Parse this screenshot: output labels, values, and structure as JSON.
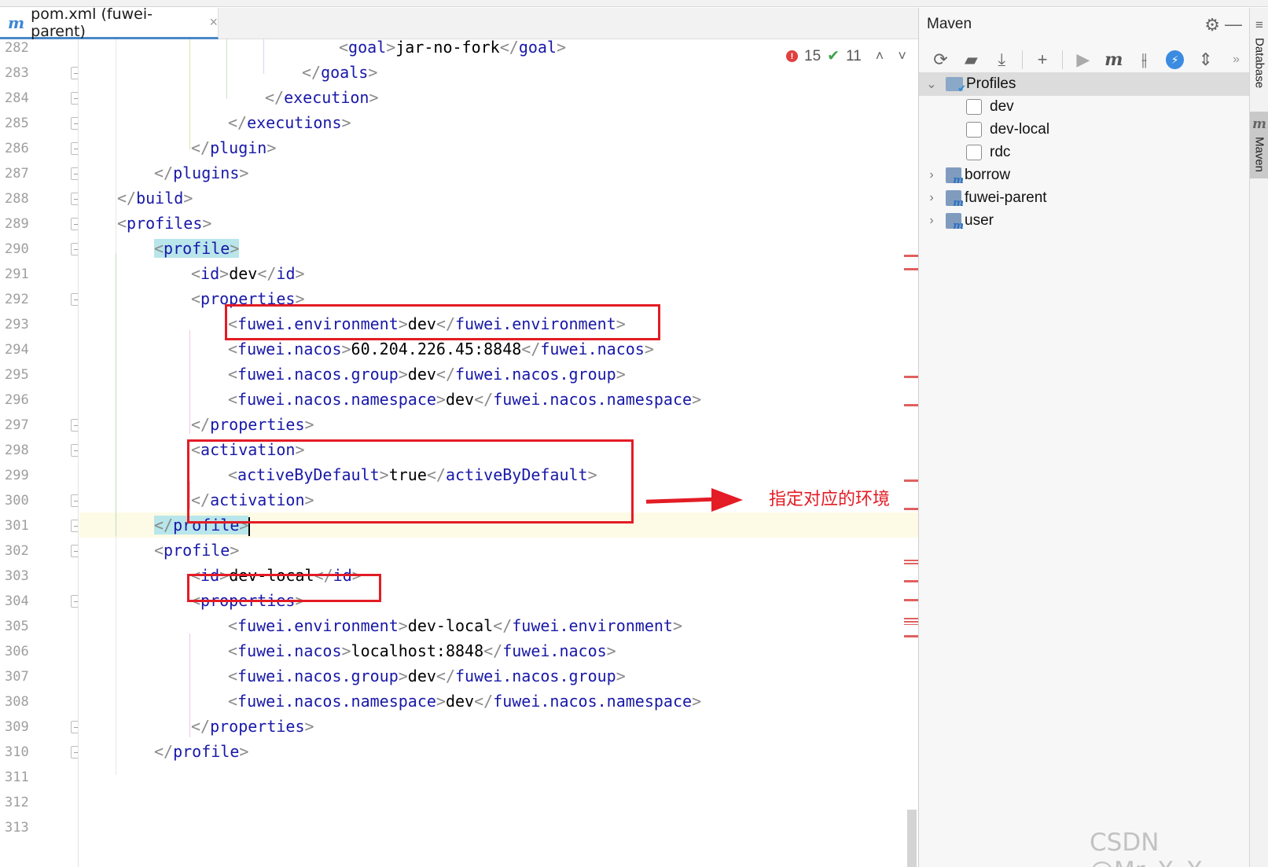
{
  "tab": {
    "icon": "m",
    "label": "pom.xml (fuwei-parent)",
    "close": "×"
  },
  "inspections": {
    "errors": "15",
    "weak_warnings": "11",
    "prev": "˄",
    "next": "˅"
  },
  "gutter": {
    "line_numbers": [
      "282",
      "283",
      "284",
      "285",
      "286",
      "287",
      "288",
      "289",
      "290",
      "291",
      "292",
      "293",
      "294",
      "295",
      "296",
      "297",
      "298",
      "299",
      "300",
      "301",
      "302",
      "303",
      "304",
      "305",
      "306",
      "307",
      "308",
      "309",
      "310",
      "311",
      "312",
      "313"
    ]
  },
  "code": {
    "lines": [
      {
        "n": "282",
        "indent": 12,
        "open": "<",
        "tag": "goal",
        "close": ">",
        "text": "jar-no-fork",
        "open2": "</",
        "tag2": "goal",
        "close2": ">"
      },
      {
        "n": "283",
        "indent": 10,
        "open": "</",
        "tag": "goals",
        "close": ">"
      },
      {
        "n": "284",
        "indent": 8,
        "open": "</",
        "tag": "execution",
        "close": ">"
      },
      {
        "n": "285",
        "indent": 6,
        "open": "</",
        "tag": "executions",
        "close": ">"
      },
      {
        "n": "286",
        "indent": 4,
        "open": "</",
        "tag": "plugin",
        "close": ">"
      },
      {
        "n": "287",
        "indent": 2,
        "open": "</",
        "tag": "plugins",
        "close": ">"
      },
      {
        "n": "288",
        "indent": 0,
        "open": "</",
        "tag": "build",
        "close": ">"
      },
      {
        "n": "289",
        "indent": 0,
        "open": "<",
        "tag": "profiles",
        "close": ">"
      },
      {
        "n": "290",
        "indent": 2,
        "open": "<",
        "tag": "profile",
        "close": ">",
        "highlight": true
      },
      {
        "n": "291",
        "indent": 4,
        "open": "<",
        "tag": "id",
        "close": ">",
        "text": "dev",
        "open2": "</",
        "tag2": "id",
        "close2": ">"
      },
      {
        "n": "292",
        "indent": 4,
        "open": "<",
        "tag": "properties",
        "close": ">"
      },
      {
        "n": "293",
        "indent": 6,
        "open": "<",
        "tag": "fuwei.environment",
        "close": ">",
        "text": "dev",
        "open2": "</",
        "tag2": "fuwei.environment",
        "close2": ">"
      },
      {
        "n": "294",
        "indent": 6,
        "open": "<",
        "tag": "fuwei.nacos",
        "close": ">",
        "text": "60.204.226.45:8848",
        "open2": "</",
        "tag2": "fuwei.nacos",
        "close2": ">"
      },
      {
        "n": "295",
        "indent": 6,
        "open": "<",
        "tag": "fuwei.nacos.group",
        "close": ">",
        "text": "dev",
        "open2": "</",
        "tag2": "fuwei.nacos.group",
        "close2": ">"
      },
      {
        "n": "296",
        "indent": 6,
        "open": "<",
        "tag": "fuwei.nacos.namespace",
        "close": ">",
        "text": "dev",
        "open2": "</",
        "tag2": "fuwei.nacos.namespace",
        "close2": ">"
      },
      {
        "n": "297",
        "indent": 4,
        "open": "</",
        "tag": "properties",
        "close": ">"
      },
      {
        "n": "298",
        "indent": 4,
        "open": "<",
        "tag": "activation",
        "close": ">"
      },
      {
        "n": "299",
        "indent": 6,
        "open": "<",
        "tag": "activeByDefault",
        "close": ">",
        "text": "true",
        "open2": "</",
        "tag2": "activeByDefault",
        "close2": ">"
      },
      {
        "n": "300",
        "indent": 4,
        "open": "</",
        "tag": "activation",
        "close": ">"
      },
      {
        "n": "301",
        "indent": 2,
        "open": "</",
        "tag": "profile",
        "close": ">",
        "highlight": true,
        "current": true
      },
      {
        "n": "302",
        "indent": 2,
        "open": "<",
        "tag": "profile",
        "close": ">"
      },
      {
        "n": "303",
        "indent": 4,
        "open": "<",
        "tag": "id",
        "close": ">",
        "text": "dev-local",
        "open2": "</",
        "tag2": "id",
        "close2": ">"
      },
      {
        "n": "304",
        "indent": 4,
        "open": "<",
        "tag": "properties",
        "close": ">"
      },
      {
        "n": "305",
        "indent": 6,
        "open": "<",
        "tag": "fuwei.environment",
        "close": ">",
        "text": "dev-local",
        "open2": "</",
        "tag2": "fuwei.environment",
        "close2": ">"
      },
      {
        "n": "306",
        "indent": 6,
        "open": "<",
        "tag": "fuwei.nacos",
        "close": ">",
        "text": "localhost:8848",
        "open2": "</",
        "tag2": "fuwei.nacos",
        "close2": ">"
      },
      {
        "n": "307",
        "indent": 6,
        "open": "<",
        "tag": "fuwei.nacos.group",
        "close": ">",
        "text": "dev",
        "open2": "</",
        "tag2": "fuwei.nacos.group",
        "close2": ">"
      },
      {
        "n": "308",
        "indent": 6,
        "open": "<",
        "tag": "fuwei.nacos.namespace",
        "close": ">",
        "text": "dev",
        "open2": "</",
        "tag2": "fuwei.nacos.namespace",
        "close2": ">"
      },
      {
        "n": "309",
        "indent": 4,
        "open": "</",
        "tag": "properties",
        "close": ">"
      },
      {
        "n": "310",
        "indent": 2,
        "open": "</",
        "tag": "profile",
        "close": ">"
      }
    ]
  },
  "annotation": {
    "text": "指定对应的环境"
  },
  "maven": {
    "title": "Maven",
    "toolbar_icons": [
      "reload-icon",
      "generate-sources-icon",
      "download-icon",
      "add-icon",
      "run-icon",
      "execute-goal-icon",
      "toggle-offline-icon",
      "skip-tests-icon",
      "collapse-all-icon",
      "more-icon"
    ],
    "profiles_label": "Profiles",
    "profiles": [
      {
        "name": "dev",
        "checked": false
      },
      {
        "name": "dev-local",
        "checked": false
      },
      {
        "name": "rdc",
        "checked": false
      }
    ],
    "projects": [
      "borrow",
      "fuwei-parent",
      "user"
    ]
  },
  "side_tabs": {
    "database": "Database",
    "maven": "Maven"
  },
  "watermark": "CSDN @Mr_X_X",
  "colors": {
    "tag": "#1818a8",
    "bracket": "#8a8a8a",
    "annotation": "#e31c25",
    "tag_highlight": "#b8e6ea",
    "current_line": "#fdfbe6"
  }
}
